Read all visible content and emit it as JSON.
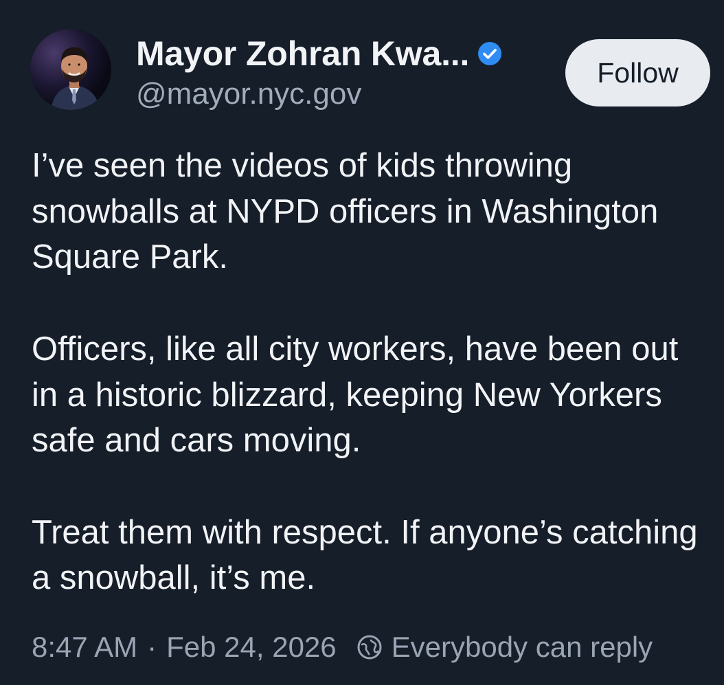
{
  "post": {
    "author": {
      "display_name": "Mayor Zohran Kwa...",
      "handle": "@mayor.nyc.gov",
      "verified": true,
      "avatar_icon": "profile-photo"
    },
    "follow_label": "Follow",
    "paragraphs": [
      "I’ve seen the videos of kids throwing snowballs at NYPD officers in Washington Square Park.",
      "Officers, like all city workers, have been out in a historic blizzard, keeping New Yorkers safe and cars moving.",
      "Treat them with respect. If anyone’s catching a snowball, it’s me."
    ],
    "time": "8:47 AM",
    "separator": "·",
    "date": "Feb 24, 2026",
    "reply_setting_icon": "globe-icon",
    "reply_setting": "Everybody can reply"
  },
  "colors": {
    "background": "#161e29",
    "text_primary": "#f1f3f6",
    "text_secondary": "#a1abba",
    "verified_badge": "#2f8cf2",
    "follow_button_bg": "#e8ecf1"
  }
}
